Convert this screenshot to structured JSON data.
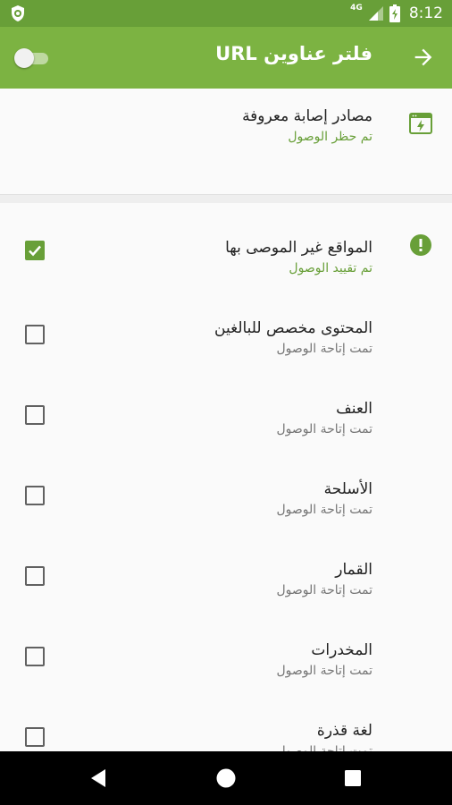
{
  "status_bar": {
    "network": "4G",
    "time": "8:12"
  },
  "app_bar": {
    "title": "فلتر عناوين URL",
    "toggle_on": false
  },
  "known_sources": {
    "title": "مصادر إصابة معروفة",
    "status": "تم حظر الوصول"
  },
  "categories": [
    {
      "title": "المواقع غير الموصى بها",
      "status": "تم تقييد الوصول",
      "checked": true,
      "status_color": "green",
      "icon": "warning-icon"
    },
    {
      "title": "المحتوى مخصص للبالغين",
      "status": "تمت إتاحة الوصول",
      "checked": false
    },
    {
      "title": "العنف",
      "status": "تمت إتاحة الوصول",
      "checked": false
    },
    {
      "title": "الأسلحة",
      "status": "تمت إتاحة الوصول",
      "checked": false
    },
    {
      "title": "القمار",
      "status": "تمت إتاحة الوصول",
      "checked": false
    },
    {
      "title": "المخدرات",
      "status": "تمت إتاحة الوصول",
      "checked": false
    },
    {
      "title": "لغة قذرة",
      "status": "تمت إتاحة الوصول",
      "checked": false
    }
  ],
  "colors": {
    "status_bar": "#689f38",
    "app_bar": "#7cb342",
    "accent_green": "#689f38"
  }
}
